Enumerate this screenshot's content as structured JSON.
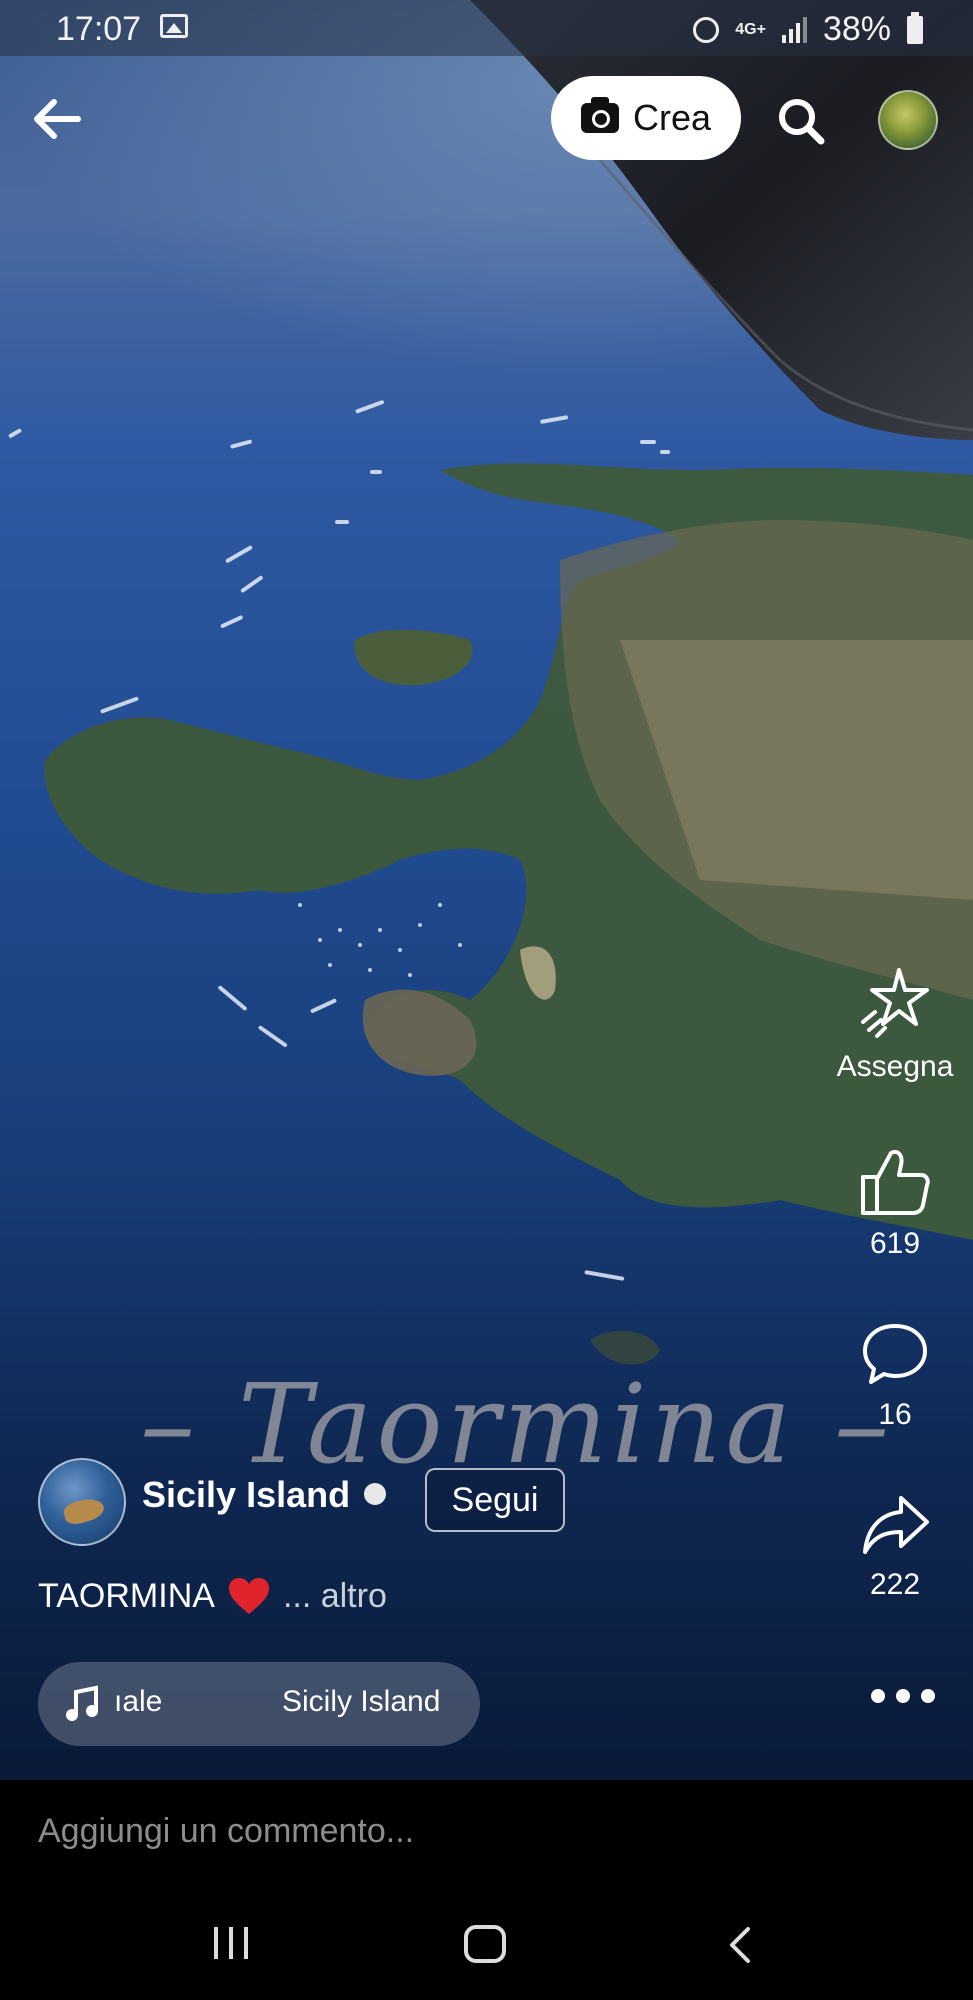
{
  "status_bar": {
    "time": "17:07",
    "network": "4G+",
    "battery": "38%"
  },
  "top_bar": {
    "create_label": "Crea"
  },
  "video": {
    "overlay_title": "– Taormina –"
  },
  "actions": {
    "assign_label": "Assegna",
    "likes": "619",
    "comments": "16",
    "shares": "222"
  },
  "page": {
    "name": "Sicily Island",
    "follow_label": "Segui"
  },
  "caption": {
    "text": "TAORMINA",
    "more": "... altro"
  },
  "music": {
    "track_fragment": "ıale",
    "artist": "Sicily Island"
  },
  "comment": {
    "placeholder": "Aggiungi un commento..."
  }
}
